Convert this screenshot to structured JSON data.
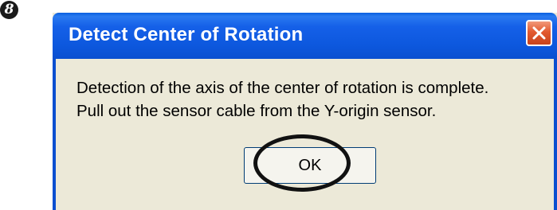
{
  "step_marker": "8",
  "dialog": {
    "title": "Detect Center of Rotation",
    "close_icon": "close-icon",
    "message_line1": "Detection of the axis of the center of rotation is complete.",
    "message_line2": "Pull out the sensor cable from the Y-origin sensor.",
    "ok_label": "OK"
  },
  "colors": {
    "title_bar": "#0a5fe0",
    "close_button": "#e2592f",
    "dialog_bg": "#ece9d8",
    "highlight_ring": "#111111"
  }
}
